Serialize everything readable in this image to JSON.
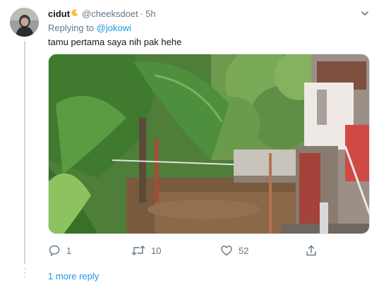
{
  "tweet": {
    "display_name": "cidut",
    "name_emoji": "crescent-moon-icon",
    "handle": "@cheeksdoet",
    "separator": "·",
    "time": "5h",
    "replying_prefix": "Replying to ",
    "replying_to": "@jokowi",
    "text": "tamu pertama saya nih pak hehe"
  },
  "actions": {
    "reply_count": "1",
    "retweet_count": "10",
    "like_count": "52"
  },
  "thread": {
    "more_replies_label": "1 more reply"
  },
  "colors": {
    "link": "#1b95e0",
    "muted": "#657786",
    "text": "#14171a",
    "border": "#e1e8ed"
  },
  "icons": [
    "chevron-down-icon",
    "reply-icon",
    "retweet-icon",
    "like-icon",
    "share-icon"
  ]
}
